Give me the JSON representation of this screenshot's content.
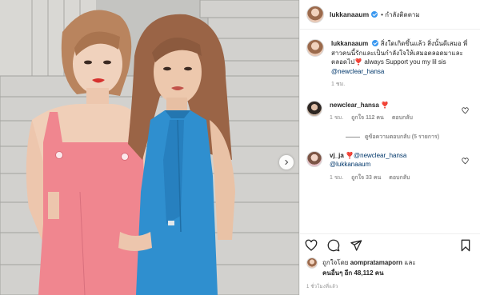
{
  "header": {
    "username": "lukkanaaum",
    "follow_label": "• กำลังติดตาม"
  },
  "caption": {
    "username": "lukkanaaum",
    "text": "สิ่งใดเกิดขึ้นแล้ว สิ่งนั้นดีเสมอ พี่สาวคนนี้รักและเป็นกำลังใจให้เสมอตลอดมาและตลอดไป❣️ always Support you my lil sis",
    "mention": "@newclear_hansa",
    "time": "1 ชม."
  },
  "comments": [
    {
      "username": "newclear_hansa",
      "text": "❣️",
      "time": "1 ชม.",
      "likes": "ถูกใจ 112 คน",
      "reply_label": "ตอบกลับ",
      "view_replies": "ดูข้อความตอบกลับ (5 รายการ)"
    },
    {
      "username": "vj_ja",
      "text": "❣️@newclear_hansa",
      "mention2": "@lukkanaaum",
      "time": "1 ชม.",
      "likes": "ถูกใจ 33 คน",
      "reply_label": "ตอบกลับ"
    }
  ],
  "likes": {
    "prefix": "ถูกใจโดย",
    "user": "aompratamaporn",
    "and": "และ",
    "others": "คนอื่นๆ อีก 48,112 คน"
  },
  "timeago": "1 ชั่วโมงที่แล้ว",
  "icons": [
    "heart-icon",
    "comment-icon",
    "share-icon",
    "bookmark-icon",
    "chevron-right-icon",
    "verified-icon"
  ],
  "colors": {
    "accent_blue": "#3897f0",
    "link_blue": "#00376b",
    "pink_dress": "#f0868f",
    "blue_dress": "#2f8fcf"
  }
}
